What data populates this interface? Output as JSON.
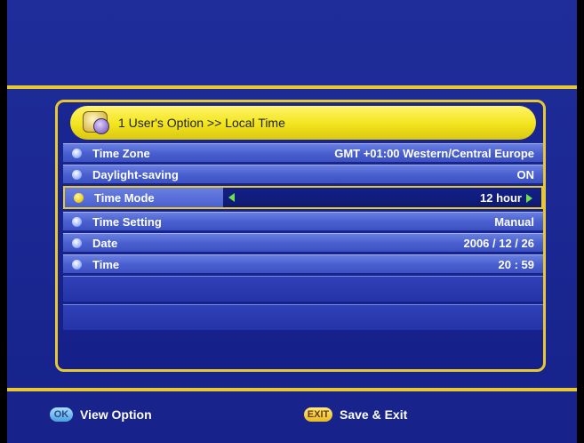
{
  "header": {
    "text": "1  User's Option >> Local Time",
    "icon": "user-option-icon"
  },
  "rows": [
    {
      "label": "Time Zone",
      "value": "GMT +01:00 Western/Central Europe"
    },
    {
      "label": "Daylight-saving",
      "value": "ON"
    },
    {
      "label": "Time Mode",
      "value": "12 hour",
      "selected": true
    },
    {
      "label": "Time Setting",
      "value": "Manual"
    },
    {
      "label": "Date",
      "value": "2006 / 12 / 26"
    },
    {
      "label": "Time",
      "value": "20 : 59"
    }
  ],
  "footer": {
    "ok_button": "OK",
    "ok_label": "View Option",
    "exit_button": "EXIT",
    "exit_label": "Save & Exit"
  },
  "colors": {
    "accent": "#e8c830",
    "background": "#1b2893",
    "row": "#4a60d0",
    "arrow": "#6ee04a"
  }
}
